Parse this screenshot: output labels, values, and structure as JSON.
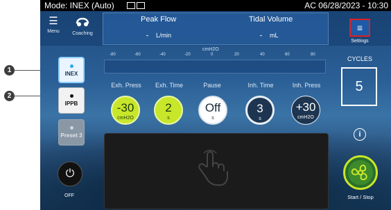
{
  "status": {
    "mode": "Mode: INEX (Auto)",
    "right": "AC  06/28/2023 - 10:30"
  },
  "top": {
    "menu_label": "Menu",
    "coaching_label": "Coaching",
    "peak_flow_title": "Peak Flow",
    "peak_flow_value": "-",
    "peak_flow_unit": "L/min",
    "tidal_title": "Tidal Volume",
    "tidal_value": "-",
    "tidal_unit": "mL",
    "settings_label": "Settings"
  },
  "scale": {
    "unit": "cmH2O",
    "ticks": [
      "-80",
      "-60",
      "-40",
      "-20",
      "0",
      "20",
      "40",
      "60",
      "80"
    ]
  },
  "modes": [
    {
      "label": "INEX",
      "active": true
    },
    {
      "label": "IPPB",
      "active": false
    },
    {
      "label": "Preset 3",
      "active": false
    }
  ],
  "params": [
    {
      "label": "Exh. Press",
      "value": "-30",
      "unit": "cmH2O",
      "style": "green"
    },
    {
      "label": "Exh. Time",
      "value": "2",
      "unit": "s",
      "style": "green"
    },
    {
      "label": "Pause",
      "value": "Off",
      "unit": "s",
      "style": "white"
    },
    {
      "label": "Inh. Time",
      "value": "3",
      "unit": "s",
      "style": "dark"
    },
    {
      "label": "Inh. Press",
      "value": "+30",
      "unit": "cmH2O",
      "style": "dark"
    }
  ],
  "cycles": {
    "label": "CYCLES",
    "value": "5"
  },
  "controls": {
    "off_label": "OFF",
    "start_label": "Start / Stop"
  },
  "callouts": [
    "1",
    "2"
  ],
  "colors": {
    "accent_green": "#c8e62a",
    "settings_highlight": "#e02020"
  }
}
